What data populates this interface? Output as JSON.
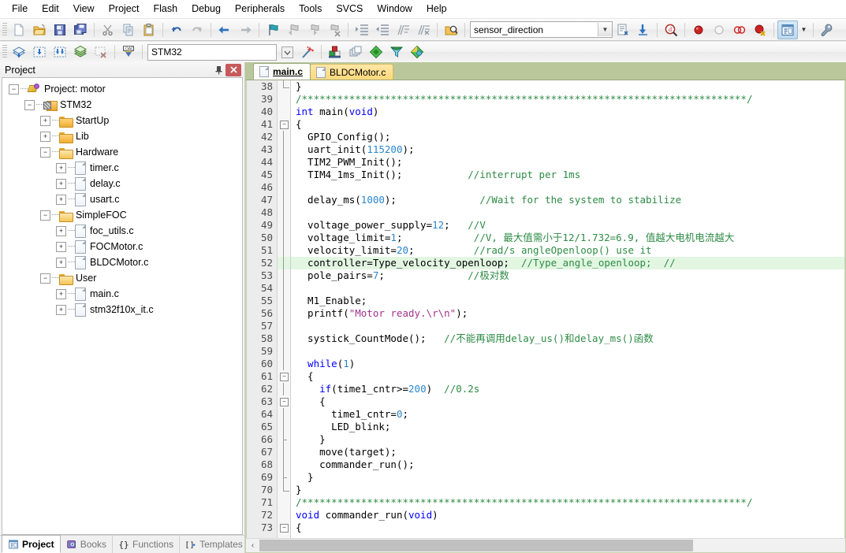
{
  "menu": {
    "items": [
      "File",
      "Edit",
      "View",
      "Project",
      "Flash",
      "Debug",
      "Peripherals",
      "Tools",
      "SVCS",
      "Window",
      "Help"
    ]
  },
  "toolbar1": {
    "buttons": [
      {
        "name": "new-file-button",
        "icon": "new-file-icon",
        "tooltip": "New"
      },
      {
        "name": "open-file-button",
        "icon": "open-folder-icon",
        "tooltip": "Open"
      },
      {
        "name": "save-button",
        "icon": "save-disk-icon",
        "tooltip": "Save"
      },
      {
        "name": "save-all-button",
        "icon": "save-all-icon",
        "tooltip": "Save All"
      },
      {
        "name": "cut-button",
        "icon": "scissors-icon",
        "tooltip": "Cut"
      },
      {
        "name": "copy-button",
        "icon": "copy-icon",
        "tooltip": "Copy"
      },
      {
        "name": "paste-button",
        "icon": "paste-clipboard-icon",
        "tooltip": "Paste"
      },
      {
        "name": "undo-button",
        "icon": "undo-arrow-icon",
        "tooltip": "Undo"
      },
      {
        "name": "redo-button",
        "icon": "redo-arrow-icon",
        "tooltip": "Redo"
      },
      {
        "name": "navigate-back-button",
        "icon": "arrow-left-icon",
        "tooltip": "Back"
      },
      {
        "name": "navigate-forward-button",
        "icon": "arrow-right-icon",
        "tooltip": "Forward"
      },
      {
        "name": "bookmark-toggle-button",
        "icon": "bookmark-flag-icon",
        "tooltip": "Insert/Remove Bookmark"
      },
      {
        "name": "bookmark-prev-button",
        "icon": "bookmark-prev-icon",
        "tooltip": "Previous Bookmark"
      },
      {
        "name": "bookmark-next-button",
        "icon": "bookmark-next-icon",
        "tooltip": "Next Bookmark"
      },
      {
        "name": "bookmark-clear-button",
        "icon": "bookmark-clear-icon",
        "tooltip": "Clear All Bookmarks"
      },
      {
        "name": "indent-right-button",
        "icon": "indent-right-icon",
        "tooltip": "Indent"
      },
      {
        "name": "indent-left-button",
        "icon": "indent-left-icon",
        "tooltip": "Outdent"
      },
      {
        "name": "comment-button",
        "icon": "comment-lines-icon",
        "tooltip": "Comment"
      },
      {
        "name": "uncomment-button",
        "icon": "uncomment-lines-icon",
        "tooltip": "Uncomment"
      },
      {
        "name": "find-in-files-button",
        "icon": "find-in-files-icon",
        "tooltip": "Find in Files"
      }
    ],
    "target_combo": {
      "value": "sensor_direction",
      "name": "target-select"
    },
    "after_combo": [
      {
        "name": "target-options-button",
        "icon": "target-options-icon"
      },
      {
        "name": "download-to-flash-button",
        "icon": "download-arrow-icon"
      },
      {
        "name": "start-debug-button",
        "icon": "debug-magnifier-icon"
      },
      {
        "name": "breakpoint-insert-button",
        "icon": "breakpoint-red-dot-icon"
      },
      {
        "name": "breakpoint-disable-button",
        "icon": "breakpoint-hollow-icon"
      },
      {
        "name": "breakpoint-kill-all-button",
        "icon": "breakpoints-kill-icon"
      },
      {
        "name": "breakpoint-disable-all-button",
        "icon": "breakpoints-disable-icon"
      },
      {
        "name": "project-window-toggle-button",
        "icon": "project-window-icon"
      },
      {
        "name": "project-window-dropdown",
        "icon": "chevron-down-icon"
      },
      {
        "name": "configure-button",
        "icon": "wrench-icon"
      }
    ]
  },
  "toolbar2": {
    "buttons": [
      {
        "name": "translate-file-button",
        "icon": "translate-icon"
      },
      {
        "name": "build-target-button",
        "icon": "build-icon"
      },
      {
        "name": "rebuild-all-button",
        "icon": "rebuild-all-icon"
      },
      {
        "name": "batch-build-button",
        "icon": "batch-build-icon"
      },
      {
        "name": "stop-build-button",
        "icon": "stop-build-icon"
      },
      {
        "name": "download-button",
        "icon": "load-download-icon"
      }
    ],
    "device_combo": {
      "value": "STM32",
      "name": "device-target-select"
    },
    "after": [
      {
        "name": "target-options-magic-button",
        "icon": "magic-wand-icon"
      },
      {
        "name": "manage-project-items-button",
        "icon": "project-components-icon"
      },
      {
        "name": "manage-multi-project-button",
        "icon": "multi-project-icon"
      },
      {
        "name": "pack-installer-button",
        "icon": "green-diamond-icon"
      },
      {
        "name": "filter-button",
        "icon": "funnel-icon"
      },
      {
        "name": "manage-run-time-button",
        "icon": "runtime-env-icon"
      }
    ]
  },
  "project_panel": {
    "title": "Project",
    "pin_glyph": "▮",
    "close_glyph": "✕",
    "tree": [
      {
        "label": "Project: motor",
        "depth": 0,
        "icon": "project-icon",
        "expander": "minus"
      },
      {
        "label": "STM32",
        "depth": 1,
        "icon": "target-icon",
        "expander": "minus"
      },
      {
        "label": "StartUp",
        "depth": 2,
        "icon": "folder-icon",
        "expander": "plus"
      },
      {
        "label": "Lib",
        "depth": 2,
        "icon": "folder-icon",
        "expander": "plus"
      },
      {
        "label": "Hardware",
        "depth": 2,
        "icon": "folder-open-icon",
        "expander": "minus"
      },
      {
        "label": "timer.c",
        "depth": 3,
        "icon": "c-file-icon",
        "expander": "plus"
      },
      {
        "label": "delay.c",
        "depth": 3,
        "icon": "c-file-icon",
        "expander": "plus"
      },
      {
        "label": "usart.c",
        "depth": 3,
        "icon": "c-file-icon",
        "expander": "plus"
      },
      {
        "label": "SimpleFOC",
        "depth": 2,
        "icon": "folder-open-icon",
        "expander": "minus"
      },
      {
        "label": "foc_utils.c",
        "depth": 3,
        "icon": "c-file-icon",
        "expander": "plus"
      },
      {
        "label": "FOCMotor.c",
        "depth": 3,
        "icon": "c-file-icon",
        "expander": "plus"
      },
      {
        "label": "BLDCMotor.c",
        "depth": 3,
        "icon": "c-file-icon",
        "expander": "plus"
      },
      {
        "label": "User",
        "depth": 2,
        "icon": "folder-open-icon",
        "expander": "minus"
      },
      {
        "label": "main.c",
        "depth": 3,
        "icon": "c-file-icon",
        "expander": "plus"
      },
      {
        "label": "stm32f10x_it.c",
        "depth": 3,
        "icon": "c-file-icon",
        "expander": "plus"
      }
    ],
    "bottom_tabs": [
      {
        "label": "Project",
        "icon": "project-window-icon",
        "selected": true
      },
      {
        "label": "Books",
        "icon": "books-icon",
        "selected": false
      },
      {
        "label": "Functions",
        "icon": "braces-icon",
        "selected": false
      },
      {
        "label": "Templates",
        "icon": "templates-icon",
        "selected": false
      }
    ]
  },
  "editor": {
    "tabs": [
      {
        "label": "main.c",
        "selected": true
      },
      {
        "label": "BLDCMotor.c",
        "selected": false
      }
    ],
    "highlight_line": 52,
    "first_line": 38,
    "hscroll": {
      "left_arrow": "‹",
      "thumb_left_pct": 0,
      "thumb_width_pct": 74
    },
    "lines": [
      {
        "n": 38,
        "fold": "end",
        "tokens": [
          {
            "t": "}",
            "c": "pln"
          }
        ]
      },
      {
        "n": 39,
        "fold": "",
        "tokens": [
          {
            "t": "/***************************************************************************/",
            "c": "cmt"
          }
        ]
      },
      {
        "n": 40,
        "fold": "",
        "tokens": [
          {
            "t": "int ",
            "c": "kw"
          },
          {
            "t": "main(",
            "c": "pln"
          },
          {
            "t": "void",
            "c": "kw"
          },
          {
            "t": ")",
            "c": "pln"
          }
        ]
      },
      {
        "n": 41,
        "fold": "open",
        "tokens": [
          {
            "t": "{",
            "c": "pln"
          }
        ]
      },
      {
        "n": 42,
        "fold": "bar",
        "tokens": [
          {
            "t": "  GPIO_Config();",
            "c": "pln"
          }
        ]
      },
      {
        "n": 43,
        "fold": "bar",
        "tokens": [
          {
            "t": "  uart_init(",
            "c": "pln"
          },
          {
            "t": "115200",
            "c": "num"
          },
          {
            "t": ");",
            "c": "pln"
          }
        ]
      },
      {
        "n": 44,
        "fold": "bar",
        "tokens": [
          {
            "t": "  TIM2_PWM_Init();",
            "c": "pln"
          }
        ]
      },
      {
        "n": 45,
        "fold": "bar",
        "tokens": [
          {
            "t": "  TIM4_1ms_Init();           ",
            "c": "pln"
          },
          {
            "t": "//interrupt per 1ms",
            "c": "cmt"
          }
        ]
      },
      {
        "n": 46,
        "fold": "bar",
        "tokens": [
          {
            "t": "",
            "c": "pln"
          }
        ]
      },
      {
        "n": 47,
        "fold": "bar",
        "tokens": [
          {
            "t": "  delay_ms(",
            "c": "pln"
          },
          {
            "t": "1000",
            "c": "num"
          },
          {
            "t": ");              ",
            "c": "pln"
          },
          {
            "t": "//Wait for the system to stabilize",
            "c": "cmt"
          }
        ]
      },
      {
        "n": 48,
        "fold": "bar",
        "tokens": [
          {
            "t": "",
            "c": "pln"
          }
        ]
      },
      {
        "n": 49,
        "fold": "bar",
        "tokens": [
          {
            "t": "  voltage_power_supply=",
            "c": "pln"
          },
          {
            "t": "12",
            "c": "num"
          },
          {
            "t": ";   ",
            "c": "pln"
          },
          {
            "t": "//V",
            "c": "cmt"
          }
        ]
      },
      {
        "n": 50,
        "fold": "bar",
        "tokens": [
          {
            "t": "  voltage_limit=",
            "c": "pln"
          },
          {
            "t": "1",
            "c": "num"
          },
          {
            "t": ";            ",
            "c": "pln"
          },
          {
            "t": "//V, 最大值需小于12/1.732=6.9, 值越大电机电流越大",
            "c": "cmt"
          }
        ]
      },
      {
        "n": 51,
        "fold": "bar",
        "tokens": [
          {
            "t": "  velocity_limit=",
            "c": "pln"
          },
          {
            "t": "20",
            "c": "num"
          },
          {
            "t": ";          ",
            "c": "pln"
          },
          {
            "t": "//rad/s angleOpenloop() use it",
            "c": "cmt"
          }
        ]
      },
      {
        "n": 52,
        "fold": "bar",
        "tokens": [
          {
            "t": "  controller=Type_velocity_openloop;  ",
            "c": "pln"
          },
          {
            "t": "//Type_angle_openloop;  //",
            "c": "cmt"
          }
        ]
      },
      {
        "n": 53,
        "fold": "bar",
        "tokens": [
          {
            "t": "  pole_pairs=",
            "c": "pln"
          },
          {
            "t": "7",
            "c": "num"
          },
          {
            "t": ";              ",
            "c": "pln"
          },
          {
            "t": "//极对数",
            "c": "cmt"
          }
        ]
      },
      {
        "n": 54,
        "fold": "bar",
        "tokens": [
          {
            "t": "",
            "c": "pln"
          }
        ]
      },
      {
        "n": 55,
        "fold": "bar",
        "tokens": [
          {
            "t": "  M1_Enable;",
            "c": "pln"
          }
        ]
      },
      {
        "n": 56,
        "fold": "bar",
        "tokens": [
          {
            "t": "  printf(",
            "c": "pln"
          },
          {
            "t": "\"Motor ready.\\r\\n\"",
            "c": "str"
          },
          {
            "t": ");",
            "c": "pln"
          }
        ]
      },
      {
        "n": 57,
        "fold": "bar",
        "tokens": [
          {
            "t": "",
            "c": "pln"
          }
        ]
      },
      {
        "n": 58,
        "fold": "bar",
        "tokens": [
          {
            "t": "  systick_CountMode();   ",
            "c": "pln"
          },
          {
            "t": "//不能再调用delay_us()和delay_ms()函数",
            "c": "cmt"
          }
        ]
      },
      {
        "n": 59,
        "fold": "bar",
        "tokens": [
          {
            "t": "",
            "c": "pln"
          }
        ]
      },
      {
        "n": 60,
        "fold": "bar",
        "tokens": [
          {
            "t": "  while",
            "c": "kw"
          },
          {
            "t": "(",
            "c": "pln"
          },
          {
            "t": "1",
            "c": "num"
          },
          {
            "t": ")",
            "c": "pln"
          }
        ]
      },
      {
        "n": 61,
        "fold": "open",
        "tokens": [
          {
            "t": "  {",
            "c": "pln"
          }
        ]
      },
      {
        "n": 62,
        "fold": "bar",
        "tokens": [
          {
            "t": "    ",
            "c": "pln"
          },
          {
            "t": "if",
            "c": "kw"
          },
          {
            "t": "(time1_cntr>=",
            "c": "pln"
          },
          {
            "t": "200",
            "c": "num"
          },
          {
            "t": ")  ",
            "c": "pln"
          },
          {
            "t": "//0.2s",
            "c": "cmt"
          }
        ]
      },
      {
        "n": 63,
        "fold": "open",
        "tokens": [
          {
            "t": "    {",
            "c": "pln"
          }
        ]
      },
      {
        "n": 64,
        "fold": "bar",
        "tokens": [
          {
            "t": "      time1_cntr=",
            "c": "pln"
          },
          {
            "t": "0",
            "c": "num"
          },
          {
            "t": ";",
            "c": "pln"
          }
        ]
      },
      {
        "n": 65,
        "fold": "bar",
        "tokens": [
          {
            "t": "      LED_blink;",
            "c": "pln"
          }
        ]
      },
      {
        "n": 66,
        "fold": "mid",
        "tokens": [
          {
            "t": "    }",
            "c": "pln"
          }
        ]
      },
      {
        "n": 67,
        "fold": "bar",
        "tokens": [
          {
            "t": "    move(target);",
            "c": "pln"
          }
        ]
      },
      {
        "n": 68,
        "fold": "bar",
        "tokens": [
          {
            "t": "    commander_run();",
            "c": "pln"
          }
        ]
      },
      {
        "n": 69,
        "fold": "mid",
        "tokens": [
          {
            "t": "  }",
            "c": "pln"
          }
        ]
      },
      {
        "n": 70,
        "fold": "end",
        "tokens": [
          {
            "t": "}",
            "c": "pln"
          }
        ]
      },
      {
        "n": 71,
        "fold": "",
        "tokens": [
          {
            "t": "/***************************************************************************/",
            "c": "cmt"
          }
        ]
      },
      {
        "n": 72,
        "fold": "",
        "tokens": [
          {
            "t": "void ",
            "c": "kw"
          },
          {
            "t": "commander_run(",
            "c": "pln"
          },
          {
            "t": "void",
            "c": "kw"
          },
          {
            "t": ")",
            "c": "pln"
          }
        ]
      },
      {
        "n": 73,
        "fold": "open",
        "tokens": [
          {
            "t": "{",
            "c": "pln"
          }
        ]
      }
    ]
  },
  "colors": {
    "keyword": "#0000ff",
    "number": "#2986cc",
    "comment": "#2e8b45",
    "string": "#a0338c",
    "highlight_line_bg": "#e2f6e2",
    "tabstrip_bg": "#b9c79a",
    "inactive_tab_bg": "#ffd97a"
  }
}
